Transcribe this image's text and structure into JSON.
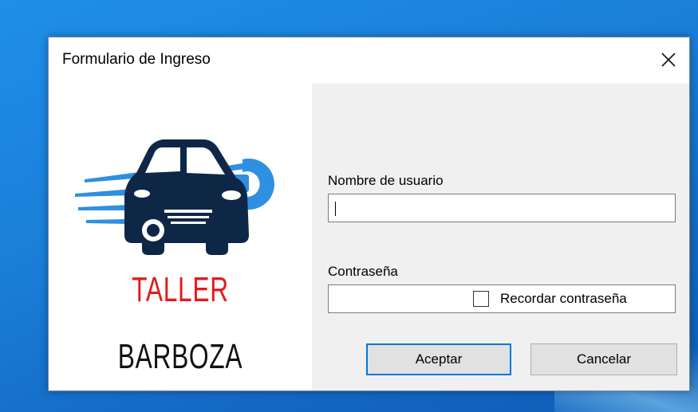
{
  "window": {
    "title": "Formulario de Ingreso",
    "close_icon": "close-icon"
  },
  "branding": {
    "line1": "TALLER",
    "line2": "BARBOZA",
    "logo_icon": "car-wrench-logo-icon",
    "colors": {
      "line1": "#e41b1b",
      "car": "#0f2747",
      "wrench": "#2f8fe0"
    }
  },
  "form": {
    "username": {
      "label": "Nombre de usuario",
      "value": ""
    },
    "password": {
      "label": "Contraseña",
      "value": ""
    },
    "remember": {
      "label": "Recordar contraseña",
      "checked": false
    },
    "accept_label": "Aceptar",
    "cancel_label": "Cancelar"
  }
}
